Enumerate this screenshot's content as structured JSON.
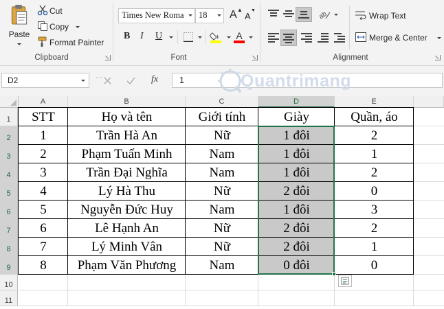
{
  "ribbon": {
    "clipboard": {
      "paste": "Paste",
      "cut": "Cut",
      "copy": "Copy",
      "format_painter": "Format Painter",
      "label": "Clipboard"
    },
    "font": {
      "font_name": "Times New Roma",
      "font_size": "18",
      "bold": "B",
      "italic": "I",
      "underline": "U",
      "font_color_glyph": "A",
      "grow": "A",
      "shrink": "A",
      "label": "Font"
    },
    "alignment": {
      "wrap_text": "Wrap Text",
      "merge_center": "Merge & Center",
      "label": "Alignment"
    },
    "colors": {
      "fill": "#ffff00",
      "font": "#ff0000"
    }
  },
  "formula_bar": {
    "name_box": "D2",
    "fx": "fx",
    "value": "1"
  },
  "watermark": "Quantrimang",
  "sheet": {
    "columns": [
      "A",
      "B",
      "C",
      "D",
      "E"
    ],
    "selected_column": "D",
    "rows": [
      "1",
      "2",
      "3",
      "4",
      "5",
      "6",
      "7",
      "8",
      "9",
      "10",
      "11"
    ],
    "headers": [
      "STT",
      "Họ và tên",
      "Giới tính",
      "Giày",
      "Quần, áo"
    ],
    "data": [
      [
        "1",
        "Trần Hà An",
        "Nữ",
        "1 đôi",
        "2"
      ],
      [
        "2",
        "Phạm Tuấn Minh",
        "Nam",
        "1 đôi",
        "1"
      ],
      [
        "3",
        "Trần Đại Nghĩa",
        "Nam",
        "1 đôi",
        "2"
      ],
      [
        "4",
        "Lý Hà Thu",
        "Nữ",
        "2 đôi",
        "0"
      ],
      [
        "5",
        "Nguyễn Đức Huy",
        "Nam",
        "1 đôi",
        "3"
      ],
      [
        "6",
        "Lê Hạnh An",
        "Nữ",
        "2 đôi",
        "2"
      ],
      [
        "7",
        "Lý Minh Vân",
        "Nữ",
        "2 đôi",
        "1"
      ],
      [
        "8",
        "Phạm Văn Phương",
        "Nam",
        "0 đôi",
        "0"
      ]
    ],
    "selection_fill": "#c9c9c9",
    "selection_border": "#217346"
  }
}
